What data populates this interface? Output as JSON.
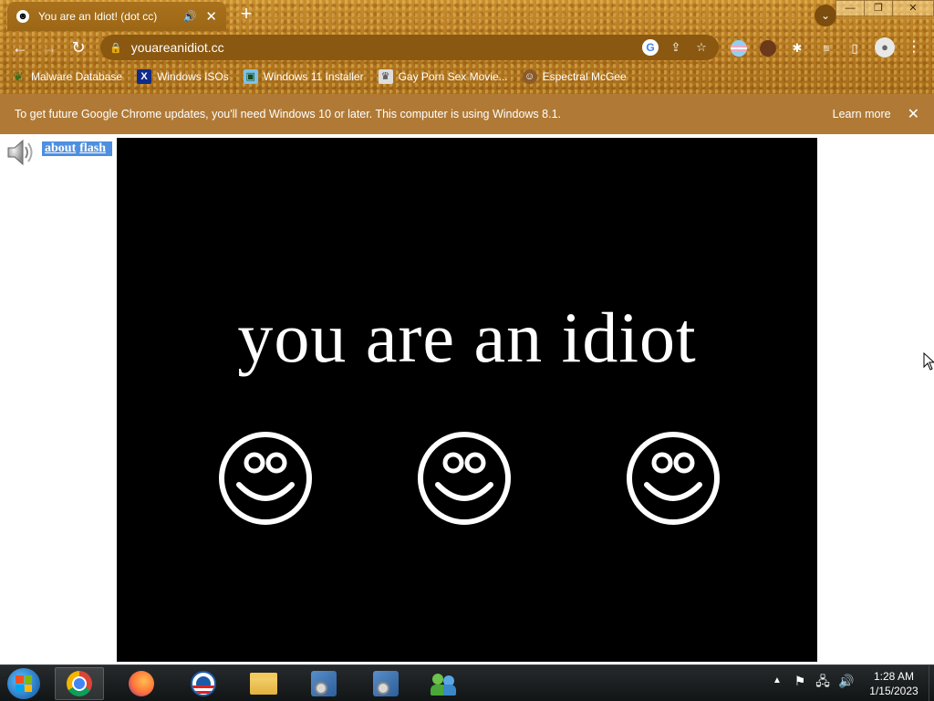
{
  "browser": {
    "tab": {
      "favicon": "☻",
      "title": "You are an Idiot! (dot cc)",
      "audio_icon": "🔊",
      "close": "✕"
    },
    "new_tab": "+",
    "window_controls": {
      "minimize": "—",
      "maximize": "❐",
      "close": "✕"
    },
    "nav": {
      "back": "←",
      "forward": "→",
      "reload": "↻"
    },
    "omnibox": {
      "url": "youareanidiot.cc"
    },
    "menu": "⋮",
    "bookmarks": [
      {
        "label": "Malware Database",
        "icon": "leaf-icon"
      },
      {
        "label": "Windows ISOs",
        "icon": "x-icon"
      },
      {
        "label": "Windows 11 Installer",
        "icon": "image-icon"
      },
      {
        "label": "Gay Porn Sex Movie...",
        "icon": "site-icon"
      },
      {
        "label": "Espectral McGee",
        "icon": "face-icon"
      }
    ]
  },
  "infobar": {
    "message": "To get future Google Chrome updates, you'll need Windows 10 or later. This computer is using Windows 8.1.",
    "learn_more": "Learn more",
    "close": "✕"
  },
  "page": {
    "links": {
      "about": "about",
      "flash": "flash"
    },
    "headline": "you are an idiot",
    "stage_color": "#000000",
    "text_color": "#ffffff",
    "smiley_count": 3
  },
  "taskbar": {
    "apps": [
      "start",
      "chrome",
      "firefox",
      "obama-browser",
      "file-explorer",
      "setup-installer-1",
      "setup-installer-2",
      "network-people"
    ],
    "clock": {
      "time": "1:28 AM",
      "date": "1/15/2023"
    }
  }
}
